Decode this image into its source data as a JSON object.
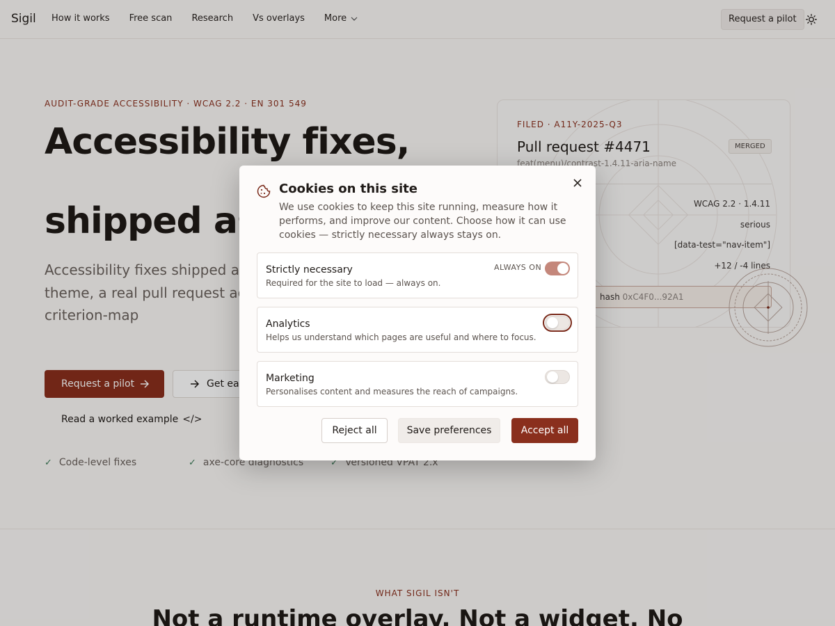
{
  "nav": {
    "brand": "Sigil",
    "links": [
      "How it works",
      "Free scan",
      "Research",
      "Vs overlays",
      "More"
    ],
    "cta": "Request a pilot"
  },
  "hero": {
    "eyebrow": "AUDIT-GRADE ACCESSIBILITY · WCAG 2.2 · EN 301 549",
    "title_line1": "Accessibility fixes,",
    "title_line2": "shipped as",
    "lead": "Accessibility fixes shipped as p proof. Sigil scans your theme, a real pull request against you finding with the criterion-map",
    "primary_cta": "Request a pilot",
    "secondary_cta": "Get ear",
    "worked_example": "Read a worked example",
    "checks": [
      "Code-level fixes",
      "axe-core diagnostics",
      "Versioned VPAT 2.x"
    ]
  },
  "pr_card": {
    "eyebrow": "FILED · A11Y-2025-Q3",
    "title": "Pull request #4471",
    "badge": "MERGED",
    "branch": "feat(menu)/contrast-1.4.11-aria-name",
    "rows": [
      "WCAG 2.2 · 1.4.11",
      "serious",
      "[data-test=\"nav-item\"]",
      "+12 / -4 lines"
    ],
    "hash_label": "hash",
    "hash_value": "0xC4F0...92A1"
  },
  "section2": {
    "eyebrow": "WHAT SIGIL ISN'T",
    "heading": "Not a runtime overlay. Not a widget. No"
  },
  "cookie_modal": {
    "title": "Cookies on this site",
    "description": "We use cookies to keep this site running, measure how it performs, and improve our content. Choose how it can use cookies — strictly necessary always stays on.",
    "categories": [
      {
        "name": "Strictly necessary",
        "description": "Required for the site to load — always on.",
        "tag": "ALWAYS ON",
        "enabled": true
      },
      {
        "name": "Analytics",
        "description": "Helps us understand which pages are useful and where to focus.",
        "enabled": false
      },
      {
        "name": "Marketing",
        "description": "Personalises content and measures the reach of campaigns.",
        "enabled": false
      }
    ],
    "buttons": {
      "reject": "Reject all",
      "save": "Save preferences",
      "accept": "Accept all"
    }
  },
  "colors": {
    "accent": "#8a2f1d",
    "toggle_on": "#c4877b",
    "success": "#3b7a57"
  }
}
